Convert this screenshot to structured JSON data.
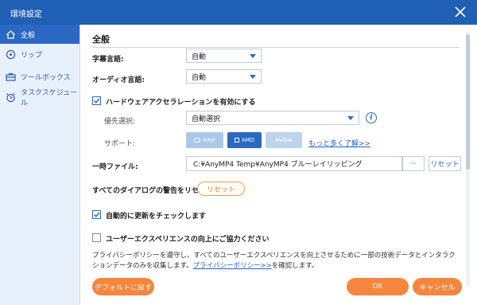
{
  "window": {
    "title": "環境設定",
    "close_icon": "close-icon"
  },
  "sidebar": {
    "items": [
      {
        "label": "全般",
        "icon": "home-icon",
        "active": true
      },
      {
        "label": "リップ",
        "icon": "disc-icon",
        "active": false
      },
      {
        "label": "ツールボックス",
        "icon": "toolbox-icon",
        "active": false
      },
      {
        "label": "タスクスケジュール",
        "icon": "alarm-clock-icon",
        "active": false
      }
    ]
  },
  "general": {
    "title": "全般",
    "subtitle_language": {
      "label": "字幕言語:",
      "value": "自動"
    },
    "audio_language": {
      "label": "オーディオ言語:",
      "value": "自動"
    },
    "hardware_accel": {
      "label": "ハードウェアアクセラレーションを有効にする",
      "checked": true,
      "priority_label": "優先選択:",
      "priority_value": "自動選択",
      "support_label": "サポート:",
      "chips": [
        "intel",
        "AMD",
        "NVIDIA"
      ],
      "learn_more": "もっと多く了解>>"
    },
    "temp_file": {
      "label": "一時ファイル:",
      "path": "C:¥AnyMP4 Temp¥AnyMP4 ブルーレイリッピング",
      "browse_label": "···",
      "reset_label": "リセット"
    },
    "dialog_reset": {
      "label": "すべてのダイアログの警告をリセット:",
      "button": "リセット"
    },
    "auto_update": {
      "label": "自動的に更新をチェックします",
      "checked": true
    },
    "ux_improve": {
      "label": "ユーザーエクスペリエンスの向上にご協力ください",
      "checked": false
    },
    "privacy": {
      "text_before": "プライバシーポリシーを遵守し、すべてのユーザーエクスペリエンスを向上させるために一部の技術データとインタラクションデータのみを収集します。",
      "link": "プライバシーポリシー>>",
      "text_after": "を確認します。"
    }
  },
  "footer": {
    "default_button": "デフォルトに戻す",
    "ok_button": "OK",
    "cancel_button": "キャンセル"
  },
  "colors": {
    "titlebar": "#1f5fb4",
    "accent": "#2a68c4",
    "orange": "#f6863d",
    "sidebar_bg": "#e8f0fb"
  }
}
